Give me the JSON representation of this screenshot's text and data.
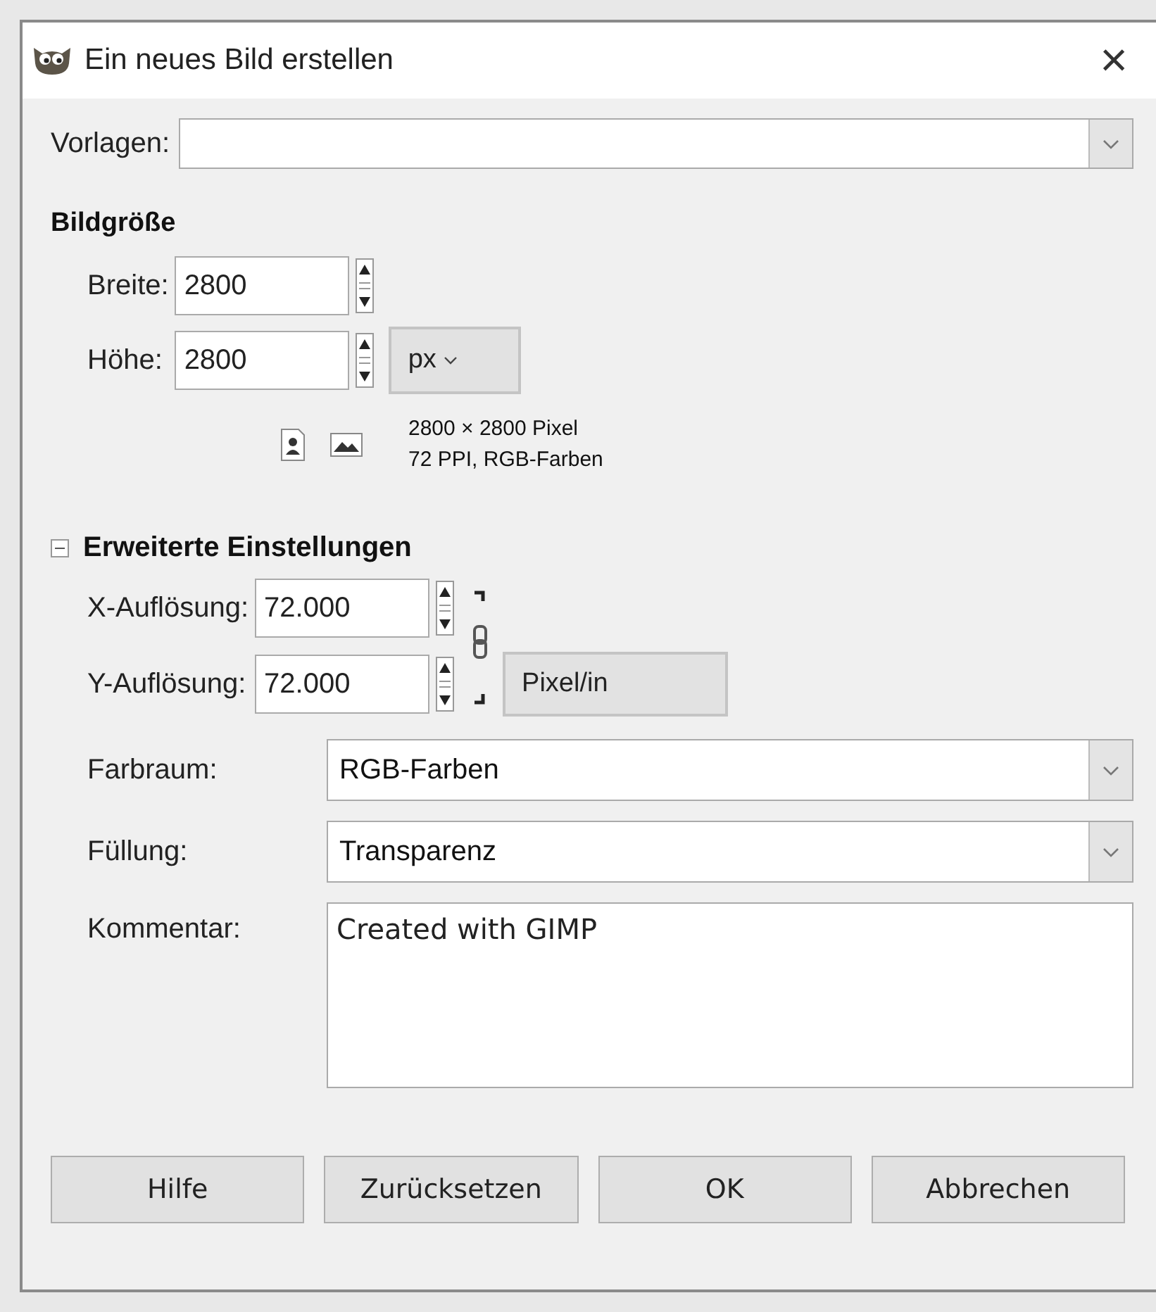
{
  "window": {
    "title": "Ein neues Bild erstellen",
    "close": "×"
  },
  "template": {
    "label": "Vorlagen:"
  },
  "image_size": {
    "heading": "Bildgröße",
    "width": {
      "label": "Breite:",
      "value": "2800"
    },
    "height": {
      "label": "Höhe:",
      "value": "2800"
    },
    "unit": "px",
    "info": [
      "2800 × 2800 Pixel",
      "72 PPI, RGB-Farben"
    ]
  },
  "advanced": {
    "heading": "Erweiterte Einstellungen",
    "expanded": true,
    "x_resolution": {
      "label": "X-Auflösung:",
      "value": "72.000"
    },
    "y_resolution": {
      "label": "Y-Auflösung:",
      "value": "72.000"
    },
    "resolution_unit": "Pixel/in",
    "selects": [
      {
        "label": "Farbraum:",
        "value": "RGB-Farben"
      },
      {
        "label": "Füllung:",
        "value": "Transparenz"
      }
    ],
    "comment": {
      "label": "Kommentar:",
      "value": "Created with GIMP"
    }
  },
  "buttons": [
    "Hilfe",
    "Zurücksetzen",
    "OK",
    "Abbrechen"
  ]
}
